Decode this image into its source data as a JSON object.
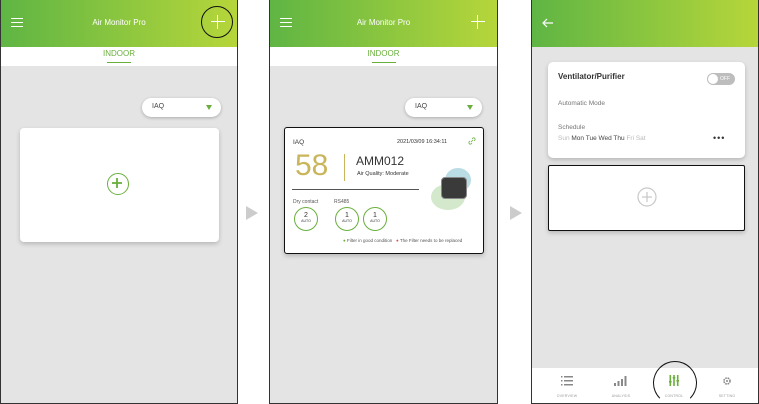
{
  "colors": {
    "green": "#6aaf3d",
    "appbar_start": "#5fb544",
    "appbar_end": "#b6d63a",
    "score_gold": "#c9b65b"
  },
  "screen1": {
    "title": "Air Monitor Pro",
    "tab": "INDOOR",
    "dropdown_label": "IAQ",
    "icons": {
      "menu": "hamburger-icon",
      "add": "plus-icon",
      "add_card": "add-circle-icon"
    }
  },
  "screen2": {
    "title": "Air Monitor Pro",
    "tab": "INDOOR",
    "dropdown_label": "IAQ",
    "card": {
      "label": "IAQ",
      "timestamp": "2021/03/09 16:34:11",
      "score": "58",
      "device_name": "AMM012",
      "quality": "Air Quality: Moderate",
      "dry_contact_label": "Dry contact",
      "rs485_label": "RS485",
      "dials": [
        {
          "value": "2",
          "mode": "AUTO"
        },
        {
          "value": "1",
          "mode": "AUTO"
        },
        {
          "value": "1",
          "mode": "AUTO"
        }
      ],
      "legend_good": "Filter in good condition",
      "legend_replace": "The Filter needs to be replaced"
    }
  },
  "screen3": {
    "card": {
      "title": "Ventilator/Purifier",
      "toggle_label": "OFF",
      "mode_label": "Automatic Mode",
      "schedule_label": "Schedule",
      "days_inactive_start": "Sun",
      "days_active": "Mon Tue Wed Thu",
      "days_inactive_end": "Fri Sat",
      "more": "•••"
    },
    "nav": [
      {
        "label": "OVERVIEW",
        "icon": "list-icon"
      },
      {
        "label": "ANALYSIS",
        "icon": "bar-chart-icon"
      },
      {
        "label": "CONTROL",
        "icon": "sliders-icon"
      },
      {
        "label": "SETTING",
        "icon": "gear-icon"
      }
    ]
  }
}
